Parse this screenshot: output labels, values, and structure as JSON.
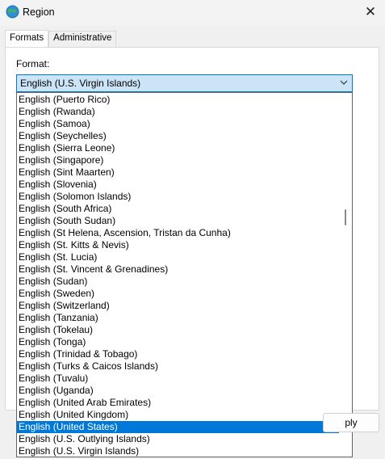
{
  "window": {
    "title": "Region",
    "close_glyph": "✕"
  },
  "tabs": [
    {
      "label": "Formats",
      "active": true
    },
    {
      "label": "Administrative",
      "active": false
    }
  ],
  "format": {
    "label": "Format:",
    "selected_value": "English (U.S. Virgin Islands)"
  },
  "dropdown": {
    "items": [
      "English (Puerto Rico)",
      "English (Rwanda)",
      "English (Samoa)",
      "English (Seychelles)",
      "English (Sierra Leone)",
      "English (Singapore)",
      "English (Sint Maarten)",
      "English (Slovenia)",
      "English (Solomon Islands)",
      "English (South Africa)",
      "English (South Sudan)",
      "English (St Helena, Ascension, Tristan da Cunha)",
      "English (St. Kitts & Nevis)",
      "English (St. Lucia)",
      "English (St. Vincent & Grenadines)",
      "English (Sudan)",
      "English (Sweden)",
      "English (Switzerland)",
      "English (Tanzania)",
      "English (Tokelau)",
      "English (Tonga)",
      "English (Trinidad & Tobago)",
      "English (Turks & Caicos Islands)",
      "English (Tuvalu)",
      "English (Uganda)",
      "English (United Arab Emirates)",
      "English (United Kingdom)",
      "English (United States)",
      "English (U.S. Outlying Islands)",
      "English (U.S. Virgin Islands)"
    ],
    "highlighted_item": "English (United States)"
  },
  "apply_button": {
    "label": "ply"
  },
  "icons": {
    "app": "globe-icon",
    "close": "close-icon",
    "combo_arrow": "chevron-down-icon"
  },
  "colors": {
    "accent": "#0078d7",
    "combo_fill": "#cce4f7",
    "window_bg": "#f0f0f0"
  }
}
